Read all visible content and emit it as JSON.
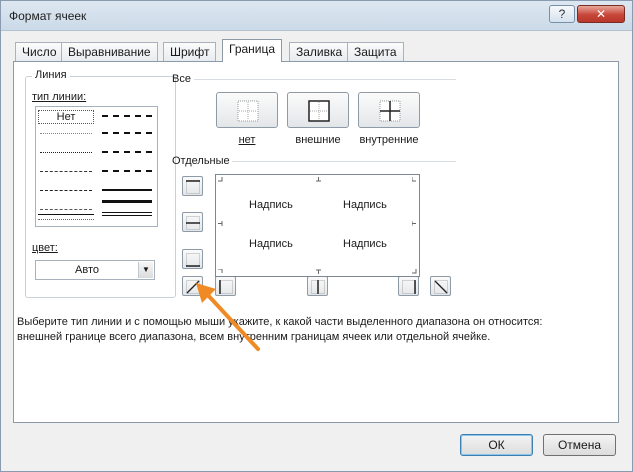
{
  "window": {
    "title": "Формат ячеек",
    "help_label": "?",
    "close_label": "✕"
  },
  "tabs": [
    {
      "label": "Число",
      "active": false
    },
    {
      "label": "Выравнивание",
      "active": false
    },
    {
      "label": "Шрифт",
      "active": false
    },
    {
      "label": "Граница",
      "active": true
    },
    {
      "label": "Заливка",
      "active": false
    },
    {
      "label": "Защита",
      "active": false
    }
  ],
  "line_group": {
    "title": "Линия",
    "style_label": "тип линии:",
    "none_label": "Нет",
    "color_label": "цвет:",
    "color_value": "Авто"
  },
  "presets": {
    "title": "Все",
    "none": "нет",
    "outline": "внешние",
    "inside": "внутренние"
  },
  "border": {
    "title": "Отдельные",
    "preview_texts": [
      "Надпись",
      "Надпись",
      "Надпись",
      "Надпись"
    ]
  },
  "description": {
    "line1": "Выберите тип линии и с помощью мыши укажите, к какой части выделенного диапазона он относится:",
    "line2": "внешней границе всего диапазона, всем внутренним границам ячеек или отдельной ячейке."
  },
  "buttons": {
    "ok": "ОК",
    "cancel": "Отмена"
  },
  "colors": {
    "accent_arrow": "#f08a24",
    "ok_border": "#3c7fb1",
    "close_red": "#c6473a"
  }
}
